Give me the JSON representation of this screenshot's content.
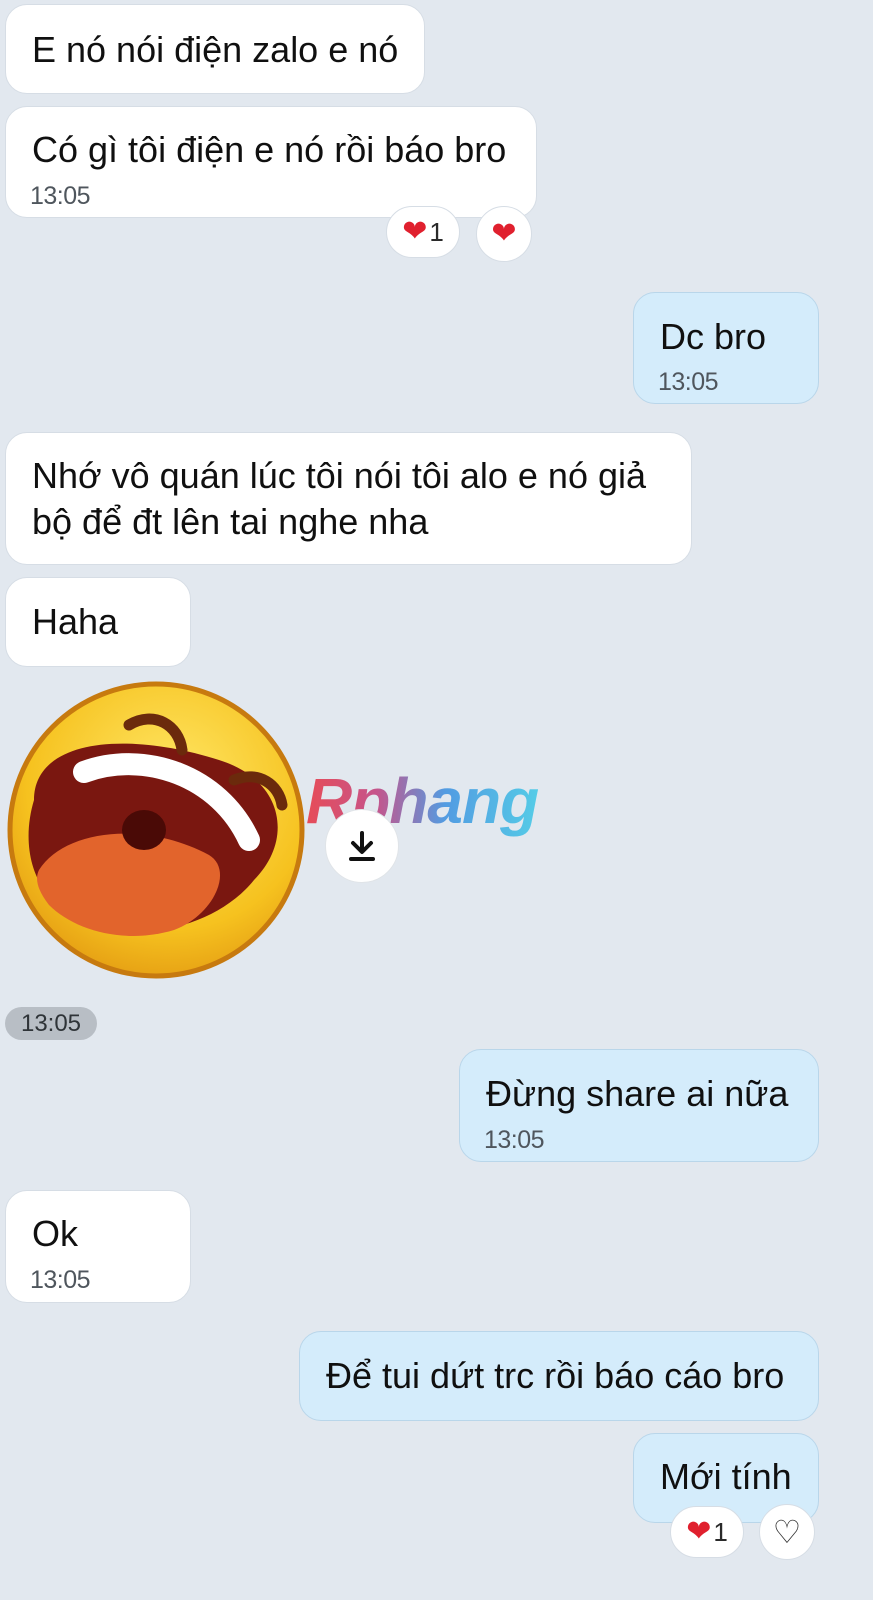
{
  "messages": [
    {
      "id": "m1",
      "text": "E nó nói điện zalo e nó"
    },
    {
      "id": "m2",
      "text": "Có gì tôi điện e nó rồi báo bro",
      "time": "13:05",
      "reactions": {
        "count": "1"
      }
    },
    {
      "id": "m3",
      "text": "Dc bro",
      "time": "13:05"
    },
    {
      "id": "m4",
      "line1": "Nhớ vô quán lúc tôi nói tôi alo e nó giả",
      "line2": "bộ để đt lên tai nghe nha"
    },
    {
      "id": "m5",
      "text": "Haha"
    },
    {
      "id": "m6",
      "time": "13:05"
    },
    {
      "id": "m7",
      "text": "Đừng share ai nữa",
      "time": "13:05"
    },
    {
      "id": "m8",
      "text": "Ok",
      "time": "13:05"
    },
    {
      "id": "m9",
      "text": "Để tui dứt trc rồi báo cáo bro"
    },
    {
      "id": "m10",
      "text": "Mới tính",
      "reactions": {
        "count": "1"
      }
    }
  ],
  "watermark": "Rphang",
  "icons": {
    "heart": "❤",
    "heart_outline": "♡",
    "download": "download-icon",
    "sticker": "laughing-emoji-sticker"
  },
  "colors": {
    "background": "#e2e8ef",
    "incoming_bubble": "#ffffff",
    "outgoing_bubble": "#d4ecfb",
    "heart": "#e0202e"
  }
}
